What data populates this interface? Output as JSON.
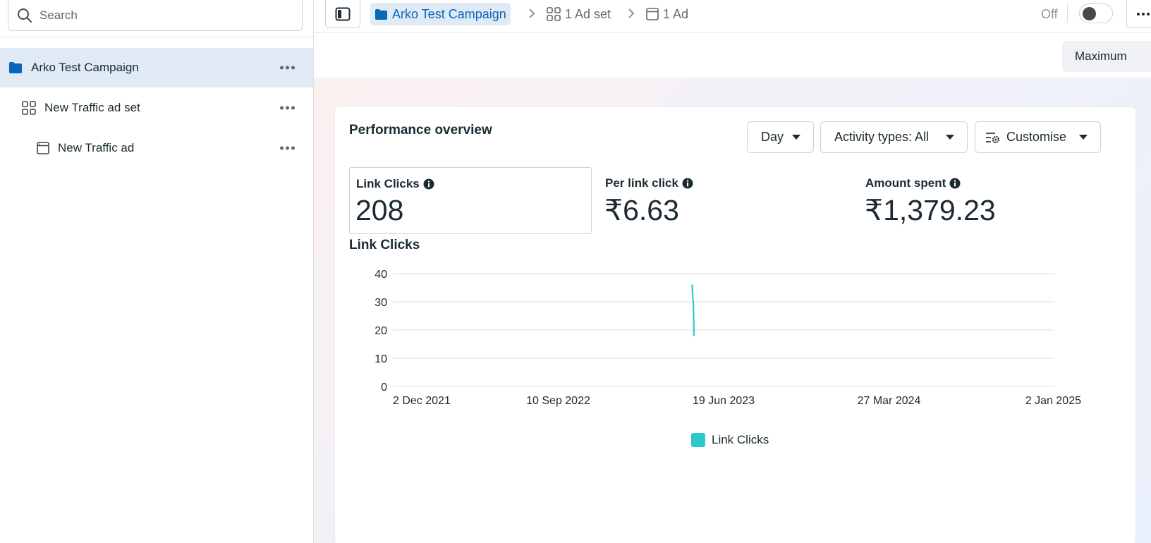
{
  "sidebar": {
    "search_placeholder": "Search",
    "items": [
      {
        "label": "Arko Test Campaign",
        "icon": "folder-icon"
      },
      {
        "label": "New Traffic ad set",
        "icon": "grid-icon"
      },
      {
        "label": "New Traffic ad",
        "icon": "ad-window-icon"
      }
    ]
  },
  "breadcrumb": {
    "campaign": "Arko Test Campaign",
    "adset": "1 Ad set",
    "ad": "1 Ad"
  },
  "status": {
    "label": "Off"
  },
  "date_range": {
    "label": "Maximum"
  },
  "overview": {
    "title": "Performance overview",
    "controls": {
      "day": "Day",
      "activity": "Activity types: All",
      "customise": "Customise"
    },
    "metrics": [
      {
        "label": "Link Clicks",
        "value": "208"
      },
      {
        "label": "Per link click",
        "value": "₹6.63"
      },
      {
        "label": "Amount spent",
        "value": "₹1,379.23"
      }
    ],
    "chart_title": "Link Clicks"
  },
  "colors": {
    "accent": "#0a66b7",
    "series": "#2bc9cb",
    "selected_bg": "#dfeaf5"
  },
  "chart_data": {
    "type": "line",
    "title": "Link Clicks",
    "xlabel": "",
    "ylabel": "",
    "x_ticks": [
      "2 Dec 2021",
      "10 Sep 2022",
      "19 Jun 2023",
      "27 Mar 2024",
      "2 Jan 2025"
    ],
    "y_ticks": [
      0,
      10,
      20,
      30,
      40
    ],
    "ylim": [
      0,
      40
    ],
    "xlim": [
      "2021-12-02",
      "2025-01-02"
    ],
    "grid": true,
    "legend": "bottom-center",
    "series": [
      {
        "name": "Link Clicks",
        "x": [
          "2023-04-26",
          "2023-04-27",
          "2023-04-28",
          "2023-04-29"
        ],
        "y": [
          36,
          31,
          30,
          18
        ]
      }
    ]
  }
}
